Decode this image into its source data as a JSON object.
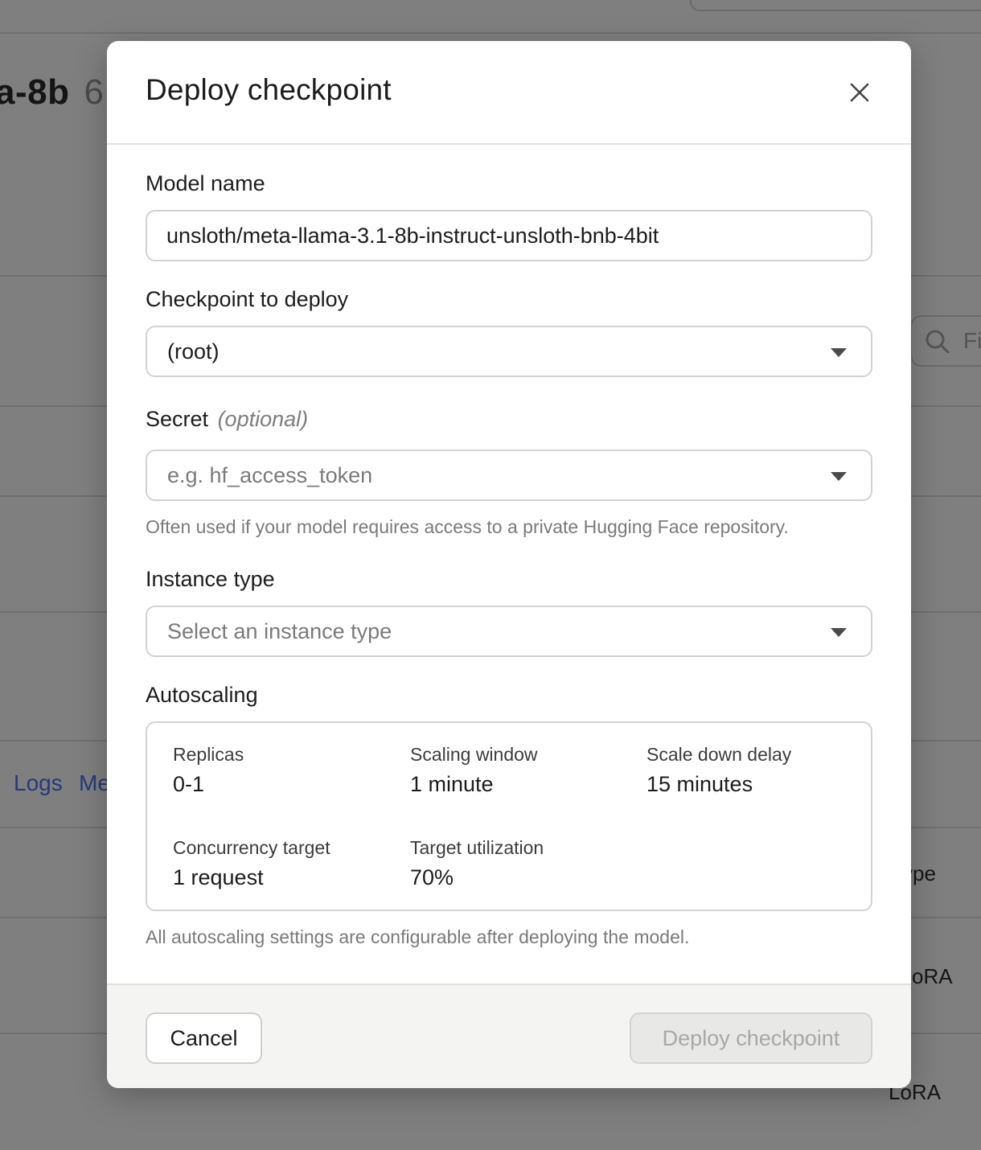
{
  "background": {
    "title": "a-8b",
    "title_num": "6",
    "filter_placeholder": "Fi",
    "tabs": [
      "Logs",
      "Me"
    ],
    "table_header_fragment": "ype",
    "table_cells": [
      "oRA",
      "LoRA"
    ]
  },
  "modal": {
    "title": "Deploy checkpoint",
    "close_icon": "close-icon",
    "model_name": {
      "label": "Model name",
      "value": "unsloth/meta-llama-3.1-8b-instruct-unsloth-bnb-4bit"
    },
    "checkpoint": {
      "label": "Checkpoint to deploy",
      "selected": "(root)"
    },
    "secret": {
      "label": "Secret",
      "optional": "(optional)",
      "placeholder": "e.g. hf_access_token",
      "help": "Often used if your model requires access to a private Hugging Face repository."
    },
    "instance_type": {
      "label": "Instance type",
      "placeholder": "Select an instance type"
    },
    "autoscaling": {
      "label": "Autoscaling",
      "stats": [
        {
          "label": "Replicas",
          "value": "0-1"
        },
        {
          "label": "Scaling window",
          "value": "1 minute"
        },
        {
          "label": "Scale down delay",
          "value": "15 minutes"
        },
        {
          "label": "Concurrency target",
          "value": "1 request"
        },
        {
          "label": "Target utilization",
          "value": "70%"
        }
      ],
      "help": "All autoscaling settings are configurable after deploying the model."
    },
    "footer": {
      "cancel_label": "Cancel",
      "deploy_label": "Deploy checkpoint"
    }
  },
  "colors": {
    "overlay": "#808080",
    "link": "#263a7a",
    "disabled_text": "#a8a8a6",
    "footer_bg": "#f4f4f3"
  }
}
